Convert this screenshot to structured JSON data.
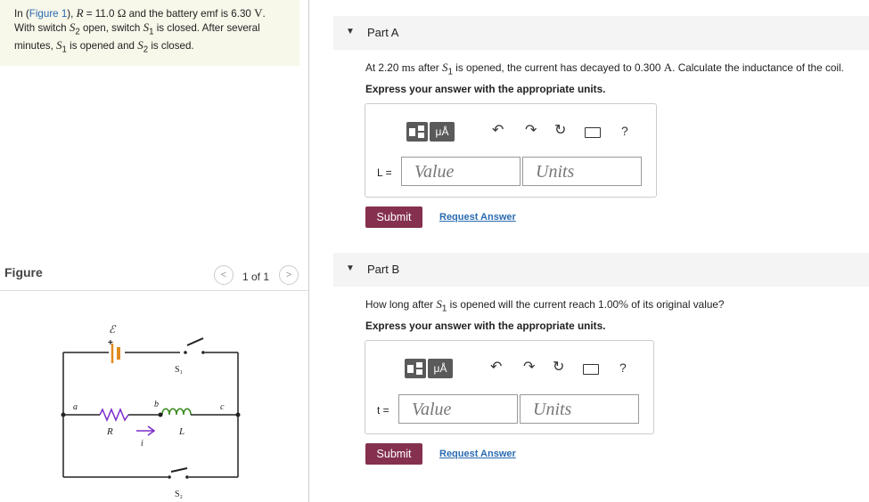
{
  "problem": {
    "pre": "In (",
    "figure_link": "Figure 1",
    "mid1": "), ",
    "r_sym": "R",
    "r_eq": " = 11.0  ",
    "omega": "Ω",
    "emf_text": " and the battery emf is 6.30 ",
    "volt": "V",
    "period": ".",
    "line2a": "With switch ",
    "s2": "S",
    "s2sub": "2",
    "line2b": " open, switch ",
    "s1": "S",
    "s1sub": "1",
    "line2c": " is closed. After several",
    "line3a": "minutes, ",
    "line3b": " is opened and ",
    "line3c": " is closed."
  },
  "figure": {
    "label": "Figure",
    "pager": "1 of 1",
    "prev": "<",
    "next": ">",
    "labels": {
      "emf": "ℰ",
      "plus": "+",
      "s1": "S₁",
      "s2": "S₂",
      "a": "a",
      "b": "b",
      "c": "c",
      "R": "R",
      "L": "L",
      "i": "i"
    }
  },
  "partA": {
    "title": "Part A",
    "q_pre": "At 2.20  ",
    "q_unit": "ms",
    "q_mid": " after ",
    "q_s": "S",
    "q_sub": "1",
    "q_mid2": " is opened, the current has decayed to 0.300 ",
    "q_amp": "A",
    "q_end": ". Calculate the inductance of the coil.",
    "instruction": "Express your answer with the appropriate units.",
    "var": "L =",
    "value_placeholder": "Value",
    "units_placeholder": "Units",
    "submit": "Submit",
    "request": "Request Answer"
  },
  "partB": {
    "title": "Part B",
    "q_pre": "How long after ",
    "q_s": "S",
    "q_sub": "1",
    "q_end": " is opened will the current reach 1.00",
    "q_pct": "%",
    "q_end2": " of its original value?",
    "instruction": "Express your answer with the appropriate units.",
    "var": "t =",
    "value_placeholder": "Value",
    "units_placeholder": "Units",
    "submit": "Submit",
    "request": "Request Answer"
  },
  "toolbar": {
    "mu": "μÅ",
    "help": "?"
  },
  "colors": {
    "submit": "#85304f",
    "link": "#2a6bb0",
    "battery": "#e08a1e",
    "resistor": "#7a2cc9",
    "inductor": "#3a8a1e",
    "arrow": "#7a2cc9"
  }
}
